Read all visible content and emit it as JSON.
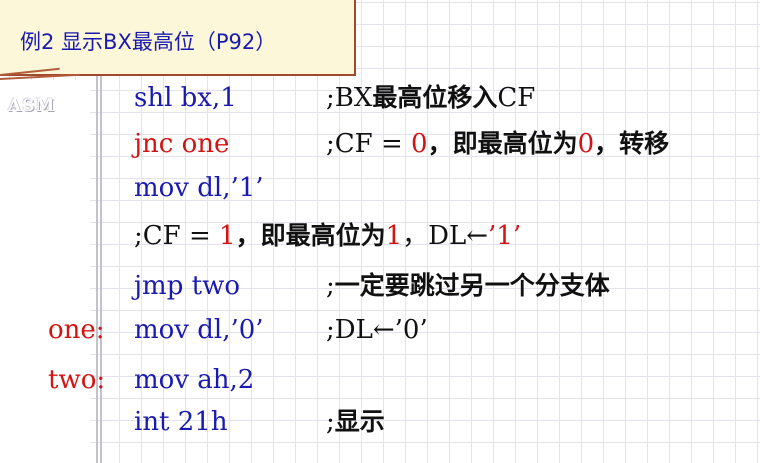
{
  "slide": {
    "title": "例2 显示BX最高位（P92）",
    "logo": "ASM"
  },
  "code": [
    {
      "label": "",
      "instr": "shl bx,1",
      "comment": [
        {
          "t": ";BX"
        },
        {
          "t": "最高位移入",
          "zh": true
        },
        {
          "t": "CF"
        }
      ]
    },
    {
      "label": "",
      "instr": "jnc one",
      "instr_red": true,
      "comment": [
        {
          "t": ";CF = "
        },
        {
          "t": "0",
          "red": true
        },
        {
          "t": "，即最高位为",
          "zh": true
        },
        {
          "t": "0",
          "red": true
        },
        {
          "t": "，转移",
          "zh": true
        }
      ]
    },
    {
      "label": "",
      "instr": "mov dl,’1’",
      "comment": []
    },
    {
      "label": "",
      "instr": "",
      "comment": [
        {
          "t": ";CF = "
        },
        {
          "t": "1",
          "red": true
        },
        {
          "t": "，即最高位为",
          "zh": true
        },
        {
          "t": "1",
          "red": true
        },
        {
          "t": "，DL←"
        },
        {
          "t": "’1’",
          "red": true
        }
      ]
    },
    {
      "label": "",
      "instr": "jmp two",
      "comment": [
        {
          "t": ";"
        },
        {
          "t": "一定要跳过另一个分支体",
          "zh": true
        }
      ]
    },
    {
      "label": "one:",
      "instr": "mov dl,’0’",
      "comment": [
        {
          "t": ";DL←’0’"
        }
      ]
    },
    {
      "label": "two:",
      "instr": "mov ah,2",
      "comment": []
    },
    {
      "label": "",
      "instr": "int 21h",
      "comment": [
        {
          "t": ";"
        },
        {
          "t": "显示",
          "zh": true
        }
      ]
    }
  ]
}
